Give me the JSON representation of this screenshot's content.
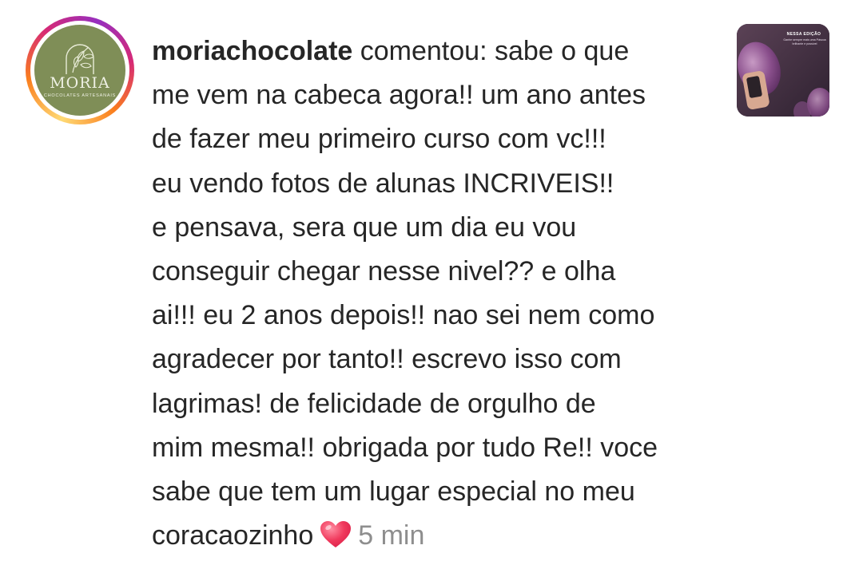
{
  "comment": {
    "username": "moriachocolate",
    "lines": [
      " comentou: sabe o que",
      "me vem na cabeca agora!! um ano antes",
      "de fazer meu primeiro curso com vc!!!",
      "eu vendo fotos de alunas INCRIVEIS!!",
      "e pensava, sera que um dia eu vou",
      "conseguir chegar nesse nivel?? e olha",
      "ai!!! eu 2 anos depois!! nao sei nem como",
      "agradecer por tanto!! escrevo isso com",
      "lagrimas! de felicidade de orgulho de",
      "mim mesma!! obrigada por tudo Re!! voce",
      "sabe que tem um lugar especial no meu",
      "coracaozinho"
    ],
    "emoji": "heart-emoji",
    "time": "5 min"
  },
  "avatar": {
    "brand": "MORIA",
    "tagline": "CHOCOLATES ARTESANAIS",
    "bg_color": "#7f8e57"
  },
  "post_thumbnail": {
    "heading": "NESSA EDIÇÃO",
    "text": "Ganhe sempre mais uma Páscoa brilhante e possível"
  },
  "colors": {
    "text": "#262626",
    "muted": "#8e8e8e",
    "heart": "#f0395c"
  }
}
